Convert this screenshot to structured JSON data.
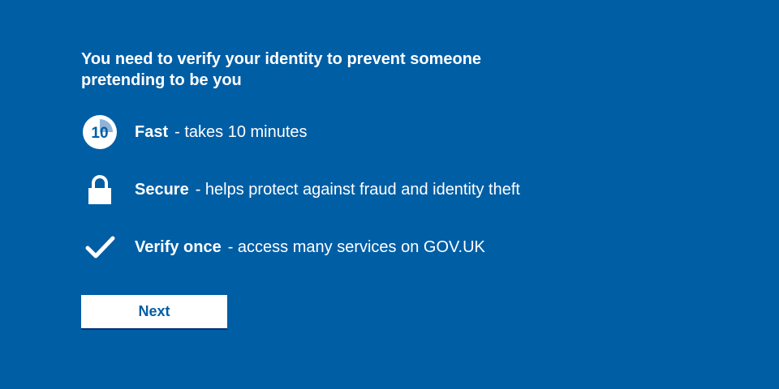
{
  "heading": "You need to verify your identity to prevent someone pretending to be you",
  "features": [
    {
      "icon": "timer-10-icon",
      "icon_text": "10",
      "title": "Fast",
      "desc": "- takes 10 minutes"
    },
    {
      "icon": "padlock-icon",
      "title": "Secure",
      "desc": "- helps protect against fraud and identity theft"
    },
    {
      "icon": "checkmark-icon",
      "title": "Verify once",
      "desc": "- access many services on GOV.UK"
    }
  ],
  "next_button": "Next",
  "colors": {
    "background": "#005ea5",
    "text": "#ffffff",
    "button_background": "#ffffff",
    "button_text": "#005ea5",
    "timer_segment": "#8fb4d8"
  }
}
